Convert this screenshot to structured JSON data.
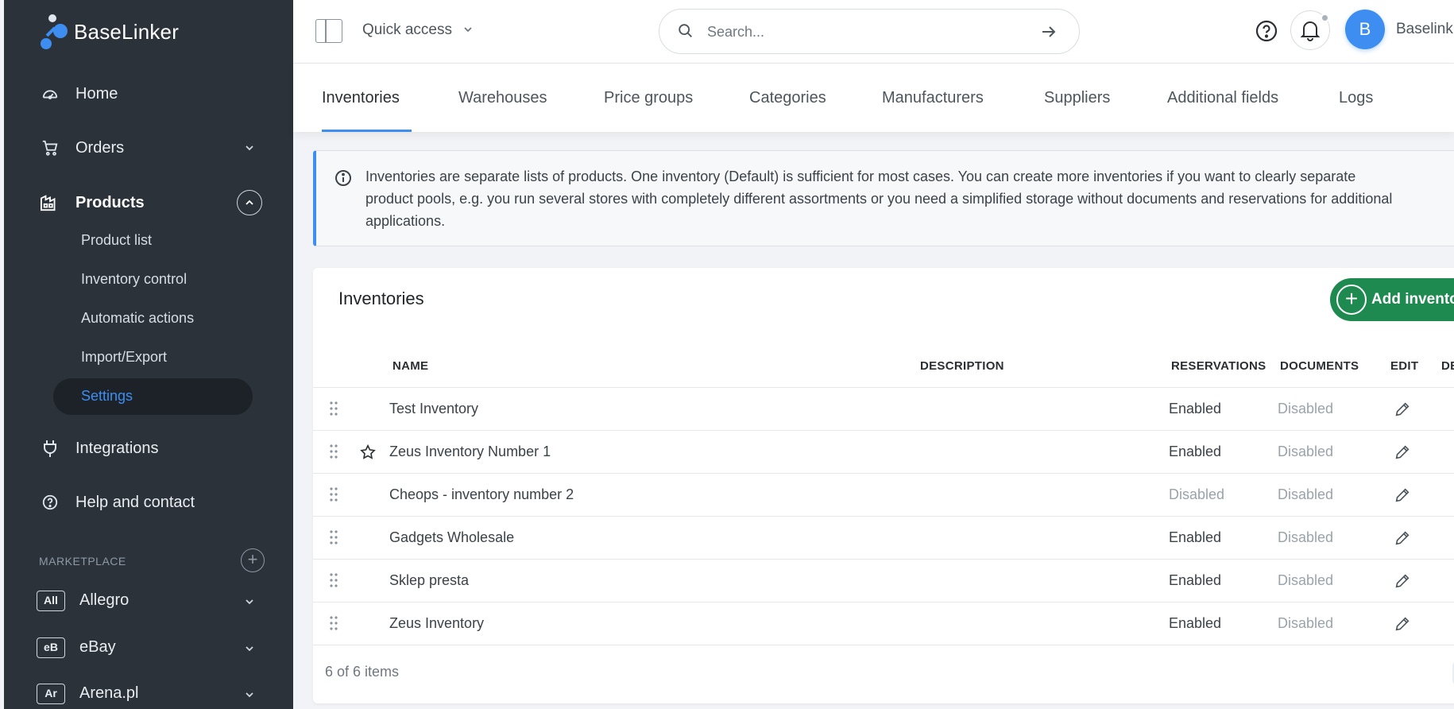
{
  "brand": {
    "name": "BaseLinker"
  },
  "sidebar": {
    "nav": [
      {
        "label": "Home",
        "icon": "dashboard-icon"
      },
      {
        "label": "Orders",
        "icon": "cart-icon"
      },
      {
        "label": "Products",
        "icon": "warehouse-icon"
      },
      {
        "label": "Integrations",
        "icon": "plug-icon"
      },
      {
        "label": "Help and contact",
        "icon": "help-icon"
      }
    ],
    "products_sub": [
      {
        "label": "Product list"
      },
      {
        "label": "Inventory control"
      },
      {
        "label": "Automatic actions"
      },
      {
        "label": "Import/Export"
      },
      {
        "label": "Settings"
      }
    ],
    "marketplace_title": "MARKETPLACE",
    "marketplace": [
      {
        "badge": "All",
        "label": "Allegro"
      },
      {
        "badge": "eB",
        "label": "eBay"
      },
      {
        "badge": "Ar",
        "label": "Arena.pl"
      }
    ]
  },
  "topbar": {
    "quick_access": "Quick access",
    "search_placeholder": "Search...",
    "avatar_letter": "B",
    "user_name": "Baselink"
  },
  "tabs": [
    {
      "label": "Inventories"
    },
    {
      "label": "Warehouses"
    },
    {
      "label": "Price groups"
    },
    {
      "label": "Categories"
    },
    {
      "label": "Manufacturers"
    },
    {
      "label": "Suppliers"
    },
    {
      "label": "Additional fields"
    },
    {
      "label": "Logs"
    }
  ],
  "info": {
    "text": "Inventories are separate lists of products. One inventory (Default) is sufficient for most cases. You can create more inventories if you want to clearly separate product pools, e.g. you run several stores with completely different assortments or you need a simplified storage without documents and reservations for additional applications."
  },
  "card": {
    "title": "Inventories",
    "add_button": "Add inventor",
    "columns": {
      "name": "NAME",
      "description": "DESCRIPTION",
      "reservations": "RESERVATIONS",
      "documents": "DOCUMENTS",
      "edit": "EDIT",
      "delete": "DE"
    },
    "rows": [
      {
        "name": "Test Inventory",
        "reservations": "Enabled",
        "documents": "Disabled"
      },
      {
        "name": "Zeus Inventory Number 1",
        "reservations": "Enabled",
        "documents": "Disabled"
      },
      {
        "name": "Cheops - inventory number 2",
        "reservations": "Disabled",
        "documents": "Disabled"
      },
      {
        "name": "Gadgets Wholesale",
        "reservations": "Enabled",
        "documents": "Disabled"
      },
      {
        "name": "Sklep presta",
        "reservations": "Enabled",
        "documents": "Disabled"
      },
      {
        "name": "Zeus Inventory",
        "reservations": "Enabled",
        "documents": "Disabled"
      }
    ],
    "footer": "6 of 6 items"
  }
}
